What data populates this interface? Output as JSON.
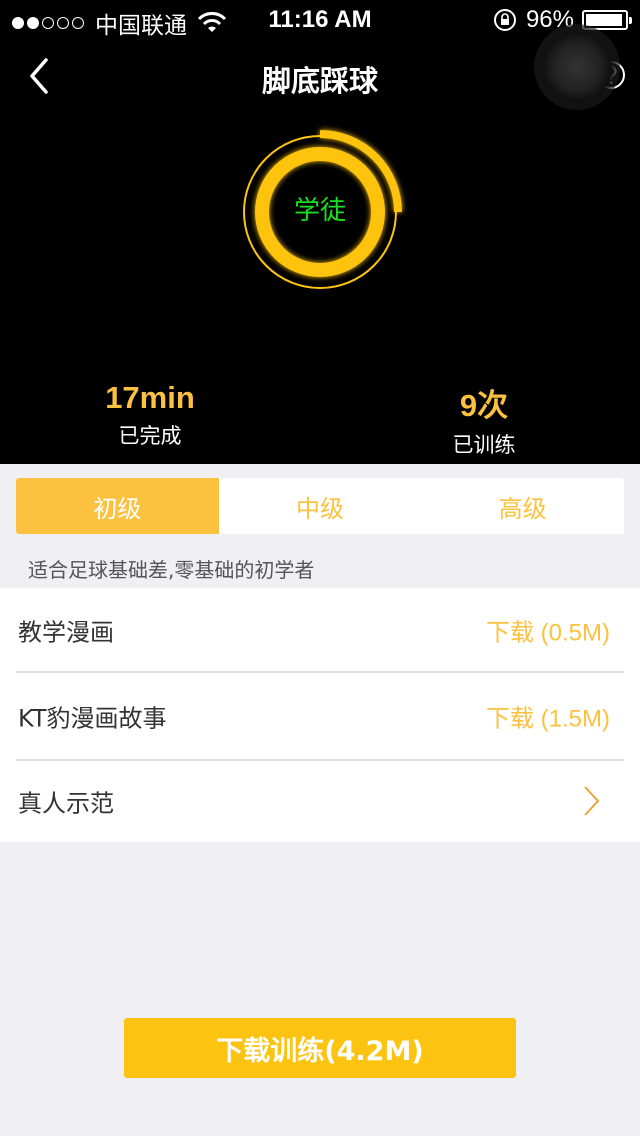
{
  "status_bar": {
    "signal_filled": 2,
    "signal_total": 5,
    "carrier": "中国联通",
    "time": "11:16 AM",
    "battery_text": "96%",
    "battery_level": 0.96
  },
  "nav": {
    "title": "脚底踩球",
    "back_icon": "chevron-left-icon",
    "help_icon": "question-circle-icon"
  },
  "rank": {
    "label": "学徒",
    "progress": 0.25
  },
  "stats": [
    {
      "value": "17min",
      "label": "已完成"
    },
    {
      "value": "9次",
      "label": "已训练"
    }
  ],
  "tabs": [
    {
      "label": "初级",
      "active": true
    },
    {
      "label": "中级",
      "active": false
    },
    {
      "label": "高级",
      "active": false
    }
  ],
  "level_description": "适合足球基础差,零基础的初学者",
  "items": [
    {
      "title": "教学漫画",
      "action": "下载 (0.5M)"
    },
    {
      "title": "KT豹漫画故事",
      "action": "下载 (1.5M)"
    },
    {
      "title": "真人示范",
      "action_icon": "chevron-right-icon"
    }
  ],
  "download_button": "下载训练(4.2M)",
  "colors": {
    "accent": "#fcc13f",
    "button": "#fdc311",
    "rank_text": "#18e01c",
    "header_bg": "#000000",
    "page_bg": "#efeff4"
  }
}
